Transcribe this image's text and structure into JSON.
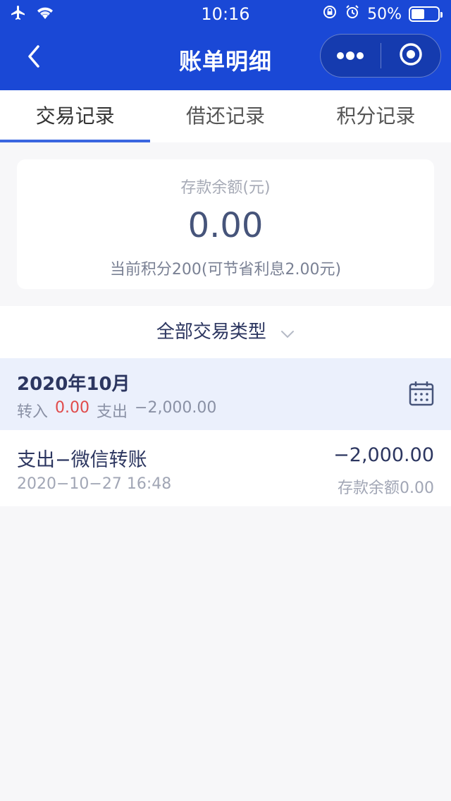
{
  "status_bar": {
    "time": "10:16",
    "battery": "50%"
  },
  "navbar": {
    "title": "账单明细",
    "back_icon": "chevron-left-icon",
    "more_icon": "more-dots-icon",
    "close_icon": "target-close-icon"
  },
  "tabs": [
    {
      "label": "交易记录",
      "active": true
    },
    {
      "label": "借还记录",
      "active": false
    },
    {
      "label": "积分记录",
      "active": false
    }
  ],
  "summary": {
    "label": "存款余额(元)",
    "amount": "0.00",
    "points_note": "当前积分200(可节省利息2.00元)"
  },
  "filter": {
    "label": "全部交易类型"
  },
  "month": {
    "title": "2020年10月",
    "in_label": "转入",
    "in_value": "0.00",
    "out_label": "支出",
    "out_value": "−2,000.00"
  },
  "transactions": [
    {
      "name": "支出−微信转账",
      "time": "2020−10−27 16:48",
      "amount": "−2,000.00",
      "balance": "存款余额0.00"
    }
  ],
  "colors": {
    "header_blue": "#1a48d6",
    "tab_indicator": "#3a66e0",
    "income_red": "#e04a4a"
  }
}
